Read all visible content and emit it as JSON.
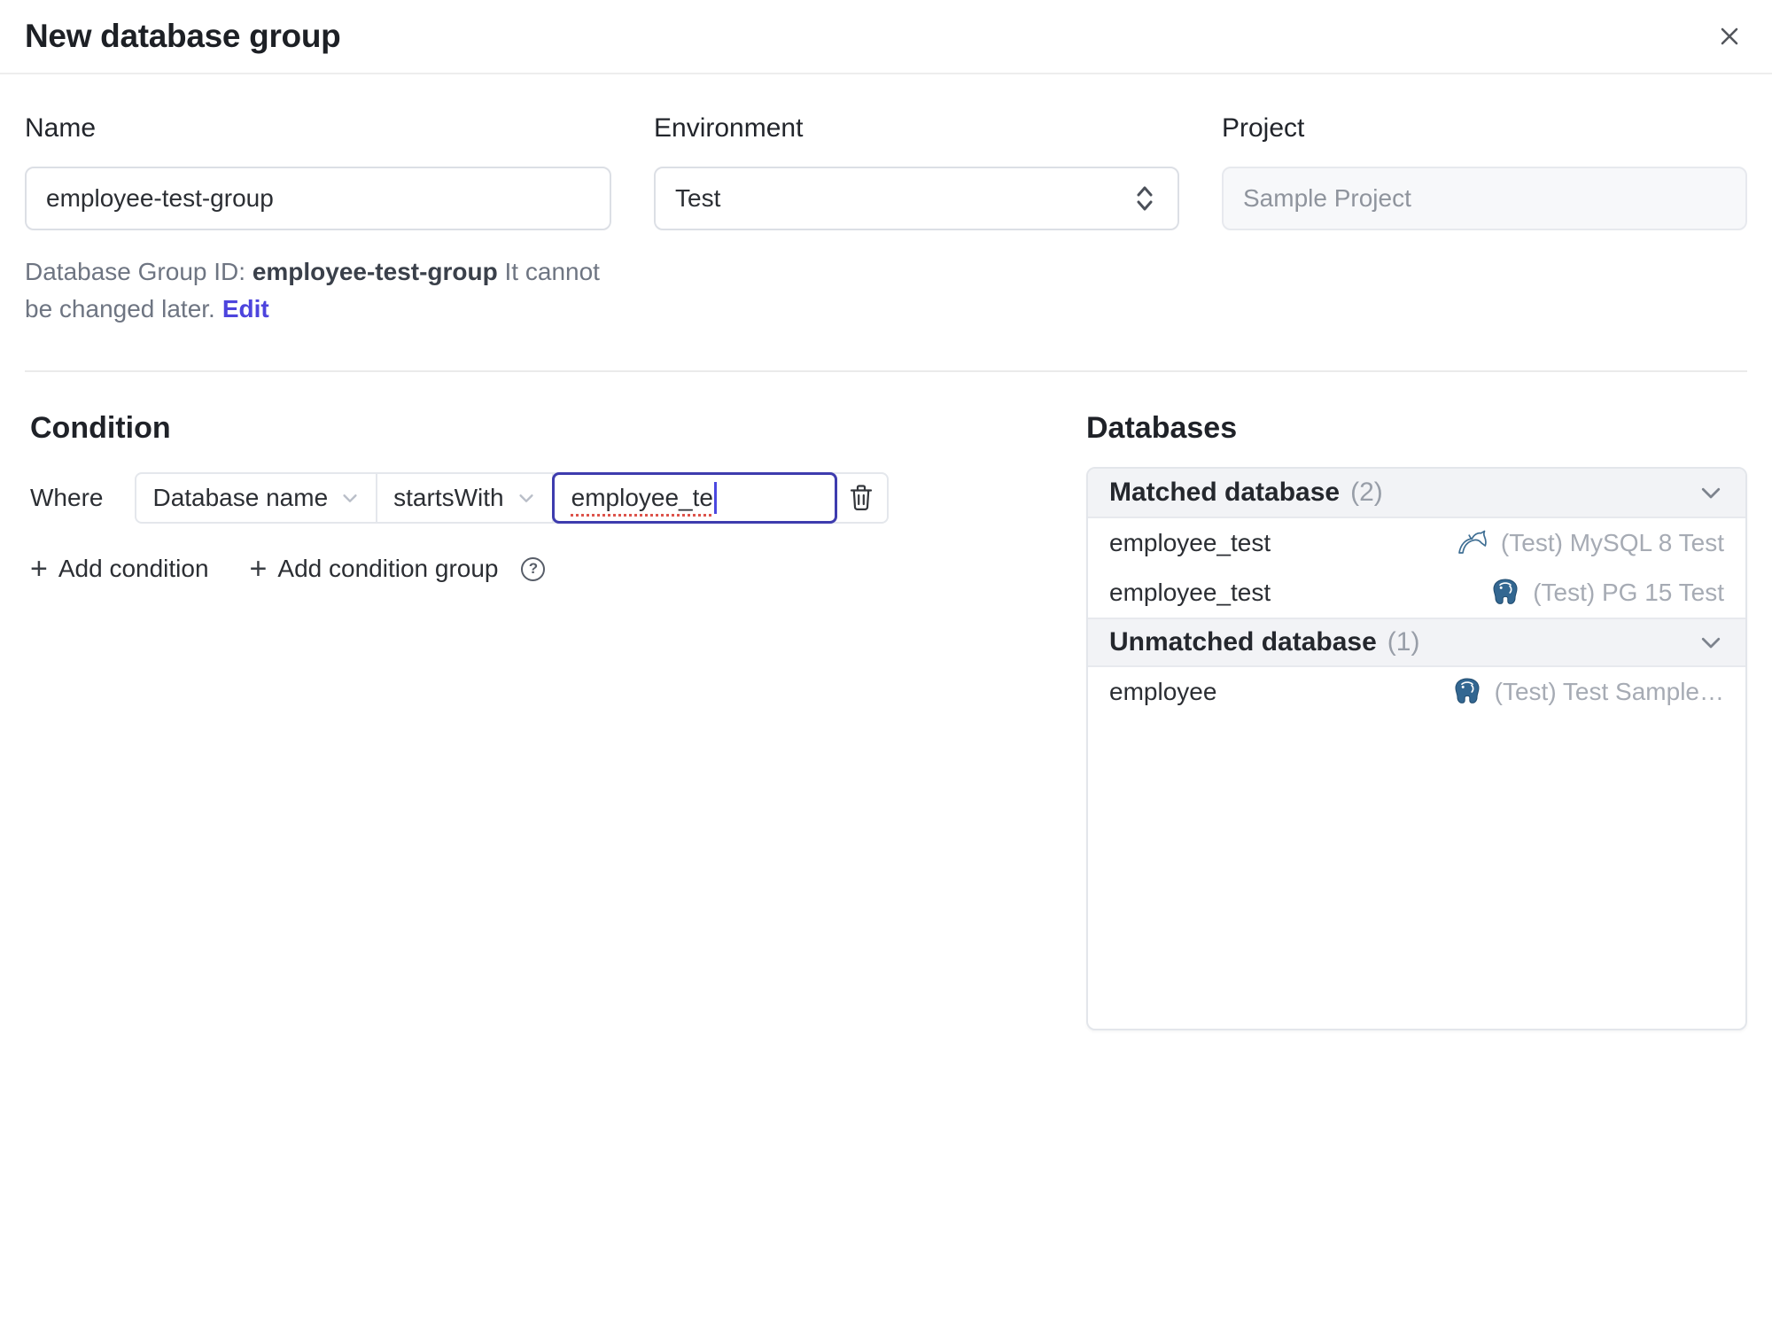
{
  "dialog": {
    "title": "New database group"
  },
  "form": {
    "name": {
      "label": "Name",
      "value": "employee-test-group"
    },
    "environment": {
      "label": "Environment",
      "value": "Test"
    },
    "project": {
      "label": "Project",
      "value": "Sample Project"
    },
    "id_hint": {
      "prefix": "Database Group ID:",
      "id": "employee-test-group",
      "suffix": "It cannot be changed later.",
      "edit_label": "Edit"
    }
  },
  "condition": {
    "heading": "Condition",
    "where_label": "Where",
    "field_select": "Database name",
    "operator_select": "startsWith",
    "value_input": "employee_te",
    "add_condition": "Add condition",
    "add_condition_group": "Add condition group"
  },
  "databases": {
    "heading": "Databases",
    "sections": [
      {
        "title": "Matched database",
        "count": "(2)",
        "rows": [
          {
            "name": "employee_test",
            "engine": "mysql",
            "instance": "(Test) MySQL 8 Test"
          },
          {
            "name": "employee_test",
            "engine": "postgres",
            "instance": "(Test) PG 15 Test"
          }
        ]
      },
      {
        "title": "Unmatched database",
        "count": "(1)",
        "rows": [
          {
            "name": "employee",
            "engine": "postgres",
            "instance": "(Test) Test Sample…"
          }
        ]
      }
    ]
  },
  "icons": {
    "plus": "+",
    "help": "?",
    "close": "✕",
    "select_updown": "chevron-up-down",
    "chevron_down": "chevron-down",
    "trash": "trash-outline",
    "mysql": "dolphin",
    "postgres": "elephant"
  },
  "colors": {
    "accent_indigo": "#4d44dd",
    "focus_border": "#3e3cae",
    "spellcheck_red": "#dd544c",
    "panel_header_bg": "#f2f3f6",
    "border_gray": "#e4e7ec",
    "muted_text": "#a6abb4",
    "mysql_blue": "#3e6e93",
    "postgres_navy": "#336791"
  }
}
